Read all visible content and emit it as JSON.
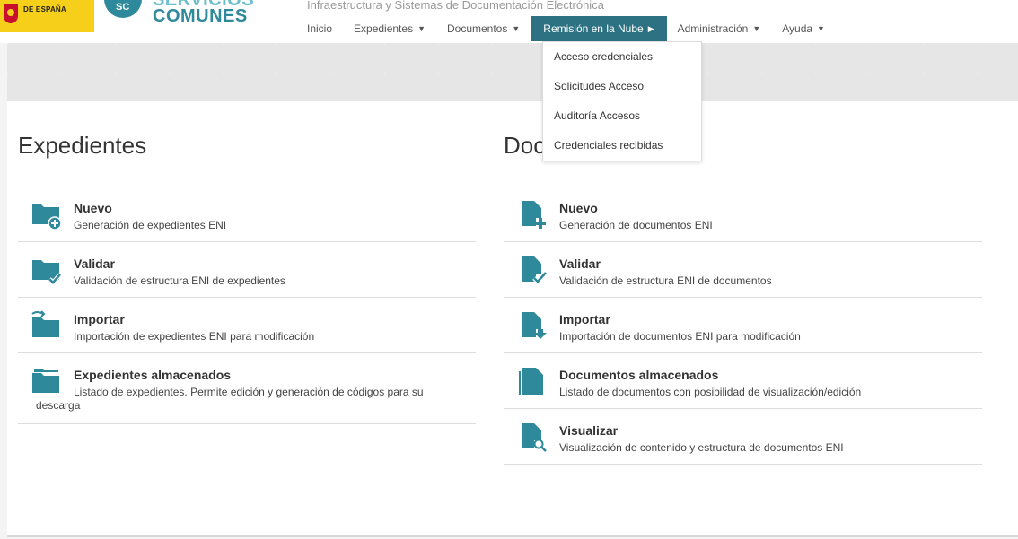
{
  "header": {
    "gov_text": "DE ESPAÑA",
    "logo_circle_text": "SC",
    "brand_top": "SERVICIOS",
    "brand": "COMUNES",
    "subtitle": "Infraestructura y Sistemas de Documentación Electrónica"
  },
  "nav": [
    {
      "label": "Inicio",
      "caret": ""
    },
    {
      "label": "Expedientes",
      "caret": "▼"
    },
    {
      "label": "Documentos",
      "caret": "▼"
    },
    {
      "label": "Remisión en la Nube",
      "caret": "▶"
    },
    {
      "label": "Administración",
      "caret": "▼"
    },
    {
      "label": "Ayuda",
      "caret": "▼"
    }
  ],
  "dropdown": [
    "Acceso credenciales",
    "Solicitudes Acceso",
    "Auditoría Accesos",
    "Credenciales recibidas"
  ],
  "expedientes": {
    "title": "Expedientes",
    "items": [
      {
        "title": "Nuevo",
        "desc": "Generación de expedientes ENI",
        "icon": "folder-plus-icon"
      },
      {
        "title": "Validar",
        "desc": "Validación de estructura ENI de expedientes",
        "icon": "folder-check-icon"
      },
      {
        "title": "Importar",
        "desc": "Importación de expedientes ENI para modificación",
        "icon": "folder-import-icon"
      },
      {
        "title": "Expedientes almacenados",
        "desc": "Listado de expedientes. Permite edición y generación de códigos para su",
        "desc2": "descarga",
        "icon": "folders-stack-icon"
      }
    ]
  },
  "documentos": {
    "title": "Documentos",
    "items": [
      {
        "title": "Nuevo",
        "desc": "Generación de documentos ENI",
        "icon": "document-plus-icon"
      },
      {
        "title": "Validar",
        "desc": "Validación de estructura ENI de documentos",
        "icon": "document-check-icon"
      },
      {
        "title": "Importar",
        "desc": "Importación de documentos ENI para modificación",
        "icon": "document-import-icon"
      },
      {
        "title": "Documentos almacenados",
        "desc": "Listado de documentos con posibilidad de visualización/edición",
        "icon": "documents-stack-icon"
      },
      {
        "title": "Visualizar",
        "desc": "Visualización de contenido y estructura de documentos ENI",
        "icon": "document-search-icon"
      }
    ]
  },
  "colors": {
    "accent": "#2c7282",
    "icon": "#2e8a9b"
  }
}
